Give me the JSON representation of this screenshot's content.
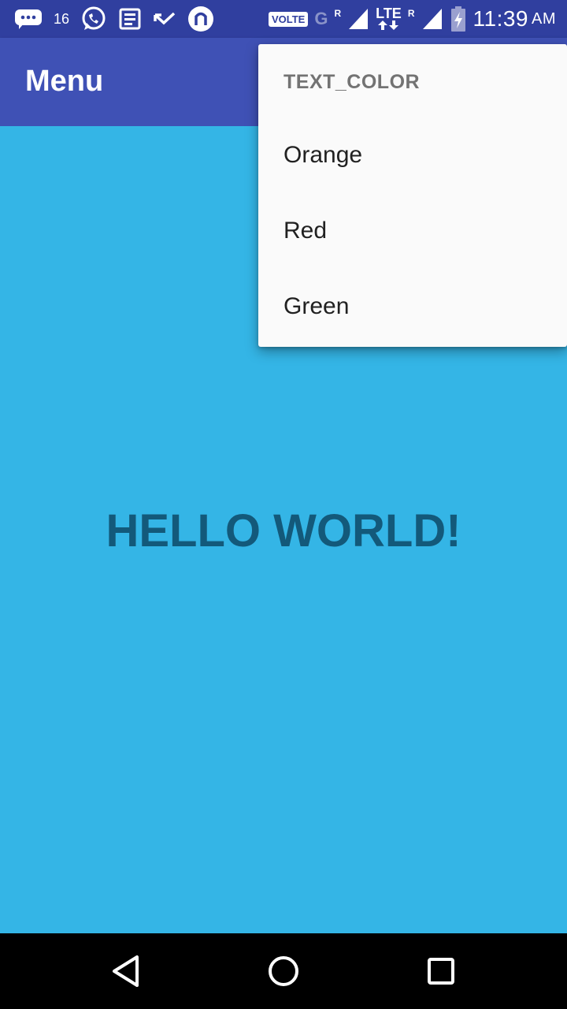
{
  "status_bar": {
    "sim_indicator": "16",
    "volte_label": "VOLTE",
    "network_g": "G",
    "roaming_r1": "R",
    "lte_label": "LTE",
    "roaming_r2": "R",
    "time": "11:39",
    "ampm": "AM",
    "icons": [
      "chat-bubble-icon",
      "sim-icon",
      "whatsapp-icon",
      "news-icon",
      "missed-call-icon",
      "home-app-icon",
      "volte-icon",
      "signal-icon",
      "battery-charging-icon"
    ]
  },
  "app_bar": {
    "title": "Menu"
  },
  "popup_menu": {
    "header": "TEXT_COLOR",
    "items": [
      "Orange",
      "Red",
      "Green"
    ]
  },
  "content": {
    "text": "HELLO WORLD!"
  },
  "colors": {
    "status_bar": "#303f9f",
    "app_bar": "#3f51b5",
    "background": "#34b5e6",
    "hello_text": "#13597a",
    "popup_bg": "#fafafa"
  },
  "nav_bar": {
    "icons": [
      "back-icon",
      "home-icon",
      "recents-icon"
    ]
  }
}
